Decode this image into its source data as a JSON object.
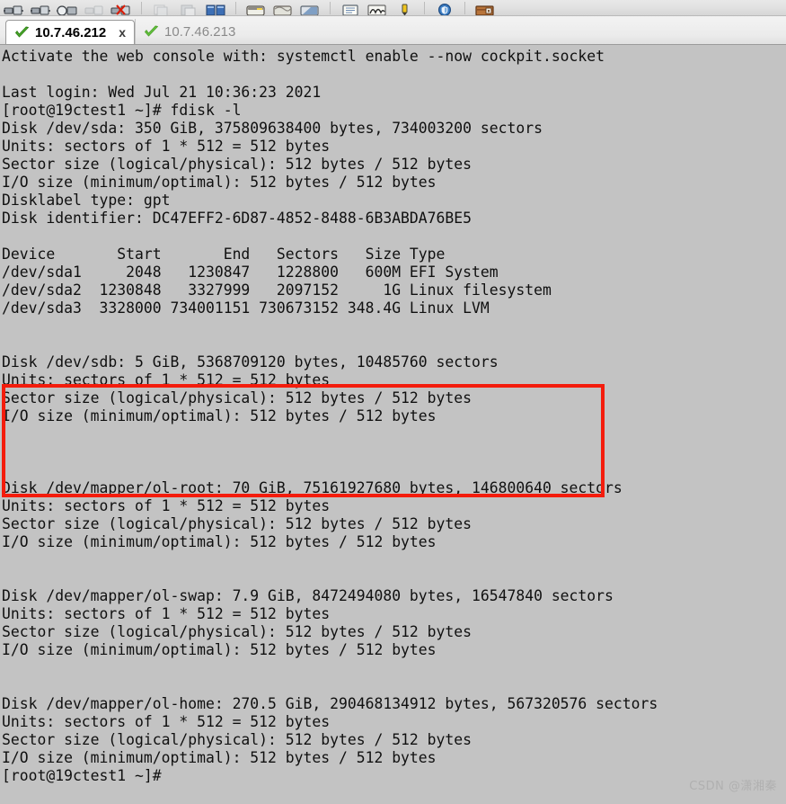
{
  "toolbar": {
    "groups": [
      {
        "buttons": [
          {
            "name": "connect-icon",
            "glyph": "connect"
          },
          {
            "name": "connect-all-icon",
            "glyph": "connect"
          },
          {
            "name": "disconnect-icon",
            "glyph": "disconnect"
          },
          {
            "name": "connect-disabled-icon",
            "glyph": "connect-dim"
          },
          {
            "name": "disconnect-all-icon",
            "glyph": "disconnect-red"
          }
        ]
      },
      {
        "buttons": [
          {
            "name": "copy-icon",
            "glyph": "copy-dim"
          },
          {
            "name": "paste-icon",
            "glyph": "paste-dim"
          },
          {
            "name": "copy-paste-icon",
            "glyph": "two-panes"
          }
        ]
      },
      {
        "buttons": [
          {
            "name": "terminal-log-icon",
            "glyph": "window-yellow"
          },
          {
            "name": "session-log-icon",
            "glyph": "window-gray"
          },
          {
            "name": "file-transfer-icon",
            "glyph": "window-blue"
          }
        ]
      },
      {
        "buttons": [
          {
            "name": "notes-icon",
            "glyph": "notes"
          },
          {
            "name": "script-icon",
            "glyph": "script"
          },
          {
            "name": "highlight-pen-icon",
            "glyph": "pen"
          }
        ]
      },
      {
        "buttons": [
          {
            "name": "security-shield-icon",
            "glyph": "shield"
          }
        ]
      },
      {
        "buttons": [
          {
            "name": "toolbox-icon",
            "glyph": "toolbox"
          }
        ]
      }
    ]
  },
  "tabs": [
    {
      "label": "10.7.46.212",
      "active": true,
      "status_icon": "green-check-icon",
      "close_label": "x"
    },
    {
      "label": "10.7.46.213",
      "active": false,
      "status_icon": "green-check-icon",
      "close_label": ""
    }
  ],
  "terminal": {
    "prompt": "[root@19ctest1 ~]#",
    "command": "fdisk -l",
    "lines": [
      "Activate the web console with: systemctl enable --now cockpit.socket",
      "",
      "Last login: Wed Jul 21 10:36:23 2021",
      "[root@19ctest1 ~]# fdisk -l",
      "Disk /dev/sda: 350 GiB, 375809638400 bytes, 734003200 sectors",
      "Units: sectors of 1 * 512 = 512 bytes",
      "Sector size (logical/physical): 512 bytes / 512 bytes",
      "I/O size (minimum/optimal): 512 bytes / 512 bytes",
      "Disklabel type: gpt",
      "Disk identifier: DC47EFF2-6D87-4852-8488-6B3ABDA76BE5",
      "",
      "Device       Start       End   Sectors   Size Type",
      "/dev/sda1     2048   1230847   1228800   600M EFI System",
      "/dev/sda2  1230848   3327999   2097152     1G Linux filesystem",
      "/dev/sda3  3328000 734001151 730673152 348.4G Linux LVM",
      "",
      "",
      "Disk /dev/sdb: 5 GiB, 5368709120 bytes, 10485760 sectors",
      "Units: sectors of 1 * 512 = 512 bytes",
      "Sector size (logical/physical): 512 bytes / 512 bytes",
      "I/O size (minimum/optimal): 512 bytes / 512 bytes",
      "",
      "",
      "",
      "Disk /dev/mapper/ol-root: 70 GiB, 75161927680 bytes, 146800640 sectors",
      "Units: sectors of 1 * 512 = 512 bytes",
      "Sector size (logical/physical): 512 bytes / 512 bytes",
      "I/O size (minimum/optimal): 512 bytes / 512 bytes",
      "",
      "",
      "Disk /dev/mapper/ol-swap: 7.9 GiB, 8472494080 bytes, 16547840 sectors",
      "Units: sectors of 1 * 512 = 512 bytes",
      "Sector size (logical/physical): 512 bytes / 512 bytes",
      "I/O size (minimum/optimal): 512 bytes / 512 bytes",
      "",
      "",
      "Disk /dev/mapper/ol-home: 270.5 GiB, 290468134912 bytes, 567320576 sectors",
      "Units: sectors of 1 * 512 = 512 bytes",
      "Sector size (logical/physical): 512 bytes / 512 bytes",
      "I/O size (minimum/optimal): 512 bytes / 512 bytes",
      "[root@19ctest1 ~]#"
    ],
    "partition_table": {
      "headers": [
        "Device",
        "Start",
        "End",
        "Sectors",
        "Size",
        "Type"
      ],
      "rows": [
        [
          "/dev/sda1",
          "2048",
          "1230847",
          "1228800",
          "600M",
          "EFI System"
        ],
        [
          "/dev/sda2",
          "1230848",
          "3327999",
          "2097152",
          "1G",
          "Linux filesystem"
        ],
        [
          "/dev/sda3",
          "3328000",
          "734001151",
          "730673152",
          "348.4G",
          "Linux LVM"
        ]
      ]
    },
    "disks": [
      {
        "device": "/dev/sda",
        "size": "350 GiB",
        "bytes": "375809638400",
        "sectors": "734003200",
        "label_type": "gpt",
        "identifier": "DC47EFF2-6D87-4852-8488-6B3ABDA76BE5"
      },
      {
        "device": "/dev/sdb",
        "size": "5 GiB",
        "bytes": "5368709120",
        "sectors": "10485760",
        "highlighted": true
      },
      {
        "device": "/dev/mapper/ol-root",
        "size": "70 GiB",
        "bytes": "75161927680",
        "sectors": "146800640"
      },
      {
        "device": "/dev/mapper/ol-swap",
        "size": "7.9 GiB",
        "bytes": "8472494080",
        "sectors": "16547840"
      },
      {
        "device": "/dev/mapper/ol-home",
        "size": "270.5 GiB",
        "bytes": "290468134912",
        "sectors": "567320576"
      }
    ]
  },
  "annotation": {
    "color": "#f41c0c",
    "target": "/dev/sdb"
  },
  "watermark": {
    "text": "CSDN @潇湘秦"
  }
}
